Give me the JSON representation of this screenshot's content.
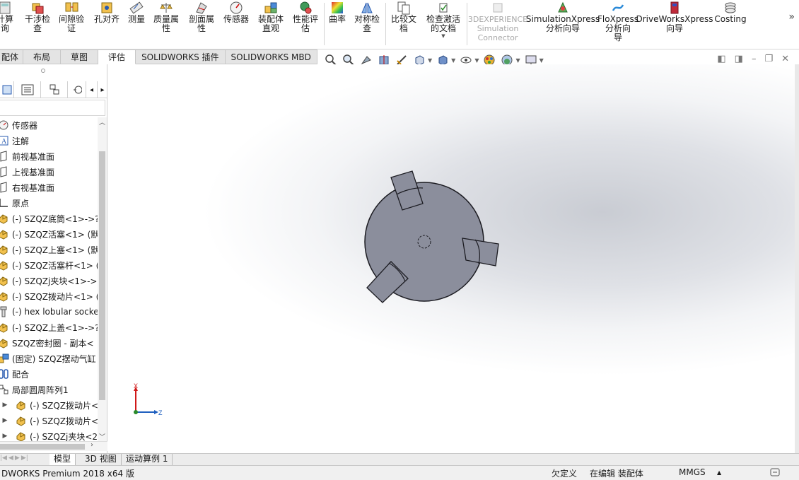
{
  "ribbon": {
    "buttons": [
      {
        "label": "计算\n询",
        "name": "calc-button"
      },
      {
        "label": "干涉检\n查",
        "name": "interference-check-button"
      },
      {
        "label": "间隙验\n证",
        "name": "clearance-verify-button"
      },
      {
        "label": "孔对齐",
        "name": "hole-align-button"
      },
      {
        "label": "测量",
        "name": "measure-button"
      },
      {
        "label": "质量属\n性",
        "name": "mass-properties-button"
      },
      {
        "label": "剖面属\n性",
        "name": "section-properties-button"
      },
      {
        "label": "传感器",
        "name": "sensor-button"
      },
      {
        "label": "装配体\n直观",
        "name": "assembly-visualization-button"
      },
      {
        "label": "性能评\n估",
        "name": "performance-eval-button"
      },
      {
        "label": "曲率",
        "name": "curvature-button"
      },
      {
        "label": "对称检\n查",
        "name": "symmetry-check-button"
      },
      {
        "label": "比较文\n档",
        "name": "compare-docs-button"
      },
      {
        "label": "检查激活\n的文档",
        "name": "check-active-doc-button"
      },
      {
        "label": "3DEXPERIENCE\nSimulation\nConnector",
        "name": "3dexperience-connector-button"
      },
      {
        "label": "SimulationXpress\n分析向导",
        "name": "simulationxpress-button"
      },
      {
        "label": "FloXpress\n分析向\n导",
        "name": "floxpress-button"
      },
      {
        "label": "DriveWorksXpress\n向导",
        "name": "driveworksxpress-button"
      },
      {
        "label": "Costing",
        "name": "costing-button"
      }
    ],
    "more": "»"
  },
  "command_tabs": [
    "配体",
    "布局",
    "草图",
    "评估",
    "SOLIDWORKS 插件",
    "SOLIDWORKS MBD"
  ],
  "active_command_tab": "评估",
  "panel_tab_arrows": {
    "left": "◂",
    "right": "▸"
  },
  "tree": [
    {
      "label": "传感器",
      "icon": "sensor-icon"
    },
    {
      "label": "注解",
      "icon": "annotation-icon"
    },
    {
      "label": "前视基准面",
      "icon": "plane-icon"
    },
    {
      "label": "上视基准面",
      "icon": "plane-icon"
    },
    {
      "label": "右视基准面",
      "icon": "plane-icon"
    },
    {
      "label": "原点",
      "icon": "origin-icon"
    },
    {
      "label": "(-) SZQZ底筒<1>->?",
      "icon": "part-icon"
    },
    {
      "label": "(-) SZQZ活塞<1> (默",
      "icon": "part-icon"
    },
    {
      "label": "(-) SZQZ上塞<1> (默",
      "icon": "part-icon"
    },
    {
      "label": "(-) SZQZ活塞杆<1> (",
      "icon": "part-icon"
    },
    {
      "label": "(-) SZQZj夹块<1>->",
      "icon": "part-icon"
    },
    {
      "label": "(-) SZQZ拨动片<1> (",
      "icon": "part-icon"
    },
    {
      "label": "(-) hex lobular socke",
      "icon": "screw-icon"
    },
    {
      "label": "(-) SZQZ上盖<1>->?",
      "icon": "part-icon"
    },
    {
      "label": "SZQZ密封圈 - 副本<",
      "icon": "part-icon"
    },
    {
      "label": "(固定) SZQZ摆动气缸",
      "icon": "subassembly-icon"
    },
    {
      "label": "配合",
      "icon": "mates-icon"
    },
    {
      "label": "局部圆周阵列1",
      "icon": "pattern-icon"
    },
    {
      "label": "(-) SZQZ拨动片<",
      "icon": "part-icon",
      "child": true
    },
    {
      "label": "(-) SZQZ拨动片<",
      "icon": "part-icon",
      "child": true
    },
    {
      "label": "(-) SZQZj夹块<2",
      "icon": "part-icon",
      "child": true
    }
  ],
  "triad": {
    "x_label": "X",
    "z_label": "Z"
  },
  "bottom_tabs": [
    "模型",
    "3D 视图",
    "运动算例 1"
  ],
  "active_bottom_tab": "模型",
  "status": {
    "product": "DWORKS Premium 2018 x64 版",
    "underdefined": "欠定义",
    "editing": "在编辑 装配体",
    "units": "MMGS",
    "units_arrow": "▲"
  },
  "window_controls": {
    "close": "✕"
  },
  "colors": {
    "model_fill": "#8b8e9c",
    "model_stroke": "#1c1c22",
    "accent": "#1f5fbf"
  }
}
